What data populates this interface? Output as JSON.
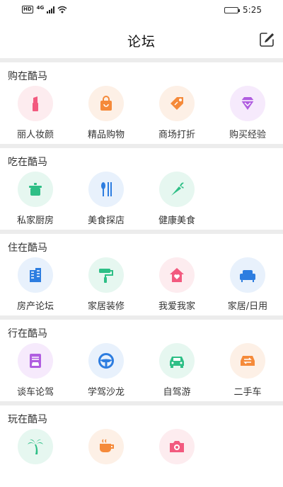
{
  "status": {
    "hd": "HD",
    "network": "4G",
    "time": "5:25",
    "battery_level": 0.85
  },
  "header": {
    "title": "论坛"
  },
  "sections": [
    {
      "title": "购在酷马",
      "items": [
        {
          "label": "丽人妆颜",
          "icon": "lipstick-icon",
          "color": "#f25a7f",
          "bg": "#fdecef"
        },
        {
          "label": "精品购物",
          "icon": "shopping-bag-icon",
          "color": "#f58a3a",
          "bg": "#fdf0e6"
        },
        {
          "label": "商场打折",
          "icon": "price-tag-icon",
          "color": "#f58a3a",
          "bg": "#fdf0e6"
        },
        {
          "label": "购买经验",
          "icon": "diamond-icon",
          "color": "#b05de0",
          "bg": "#f6eafc"
        }
      ]
    },
    {
      "title": "吃在酷马",
      "items": [
        {
          "label": "私家厨房",
          "icon": "cooking-pot-icon",
          "color": "#2ebf86",
          "bg": "#e6f7f0"
        },
        {
          "label": "美食探店",
          "icon": "utensils-icon",
          "color": "#2d7de0",
          "bg": "#e8f1fc"
        },
        {
          "label": "健康美食",
          "icon": "carrot-icon",
          "color": "#2ebf86",
          "bg": "#e6f7f0"
        }
      ]
    },
    {
      "title": "住在酷马",
      "items": [
        {
          "label": "房产论坛",
          "icon": "building-icon",
          "color": "#2d7de0",
          "bg": "#e8f1fc"
        },
        {
          "label": "家居装修",
          "icon": "paint-roller-icon",
          "color": "#2ebf86",
          "bg": "#e6f7f0"
        },
        {
          "label": "我爱我家",
          "icon": "home-heart-icon",
          "color": "#f25a7f",
          "bg": "#fdecef"
        },
        {
          "label": "家居/日用",
          "icon": "sofa-icon",
          "color": "#2d7de0",
          "bg": "#e8f1fc"
        }
      ]
    },
    {
      "title": "行在酷马",
      "items": [
        {
          "label": "谈车论驾",
          "icon": "car-document-icon",
          "color": "#b05de0",
          "bg": "#f6eafc"
        },
        {
          "label": "学驾沙龙",
          "icon": "steering-wheel-icon",
          "color": "#2d7de0",
          "bg": "#e8f1fc"
        },
        {
          "label": "自驾游",
          "icon": "car-icon",
          "color": "#2ebf86",
          "bg": "#e6f7f0"
        },
        {
          "label": "二手车",
          "icon": "car-exchange-icon",
          "color": "#f58a3a",
          "bg": "#fdf0e6"
        }
      ]
    },
    {
      "title": "玩在酷马",
      "items": [
        {
          "label": "",
          "icon": "palm-tree-icon",
          "color": "#2ebf86",
          "bg": "#e6f7f0"
        },
        {
          "label": "",
          "icon": "coffee-cup-icon",
          "color": "#f58a3a",
          "bg": "#fdf0e6"
        },
        {
          "label": "",
          "icon": "camera-icon",
          "color": "#f25a7f",
          "bg": "#fdecef"
        }
      ]
    }
  ]
}
